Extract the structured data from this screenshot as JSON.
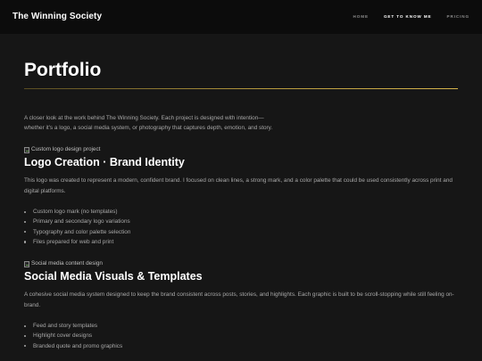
{
  "header": {
    "brand": "The Winning Society",
    "nav": [
      {
        "label": "HOME"
      },
      {
        "label": "GET TO KNOW ME"
      },
      {
        "label": "PRICING"
      }
    ]
  },
  "page": {
    "title": "Portfolio",
    "intro_line1": "A closer look at the work behind The Winning Society. Each project is designed with intention—",
    "intro_line2": "whether it's a logo, a social media system, or photography that captures depth, emotion, and story."
  },
  "sections": [
    {
      "image_alt": "Custom logo design project",
      "title": "Logo Creation · Brand Identity",
      "description": "This logo was created to represent a modern, confident brand. I focused on clean lines, a strong mark, and a color palette that could be used consistently across print and digital platforms.",
      "features": [
        "Custom logo mark (no templates)",
        "Primary and secondary logo variations",
        "Typography and color palette selection",
        "Files prepared for web and print"
      ]
    },
    {
      "image_alt": "Social media content design",
      "title": "Social Media Visuals & Templates",
      "description": "A cohesive social media system designed to keep the brand consistent across posts, stories, and highlights. Each graphic is built to be scroll-stopping while still feeling on-brand.",
      "features": [
        "Feed and story templates",
        "Highlight cover designs",
        "Branded quote and promo graphics"
      ]
    }
  ],
  "colors": {
    "background": "#161616",
    "header_background": "#0c0c0c",
    "accent_rule": "#b79a3e",
    "text_muted": "#a8a8a8",
    "nav_active": "#ffffff"
  }
}
